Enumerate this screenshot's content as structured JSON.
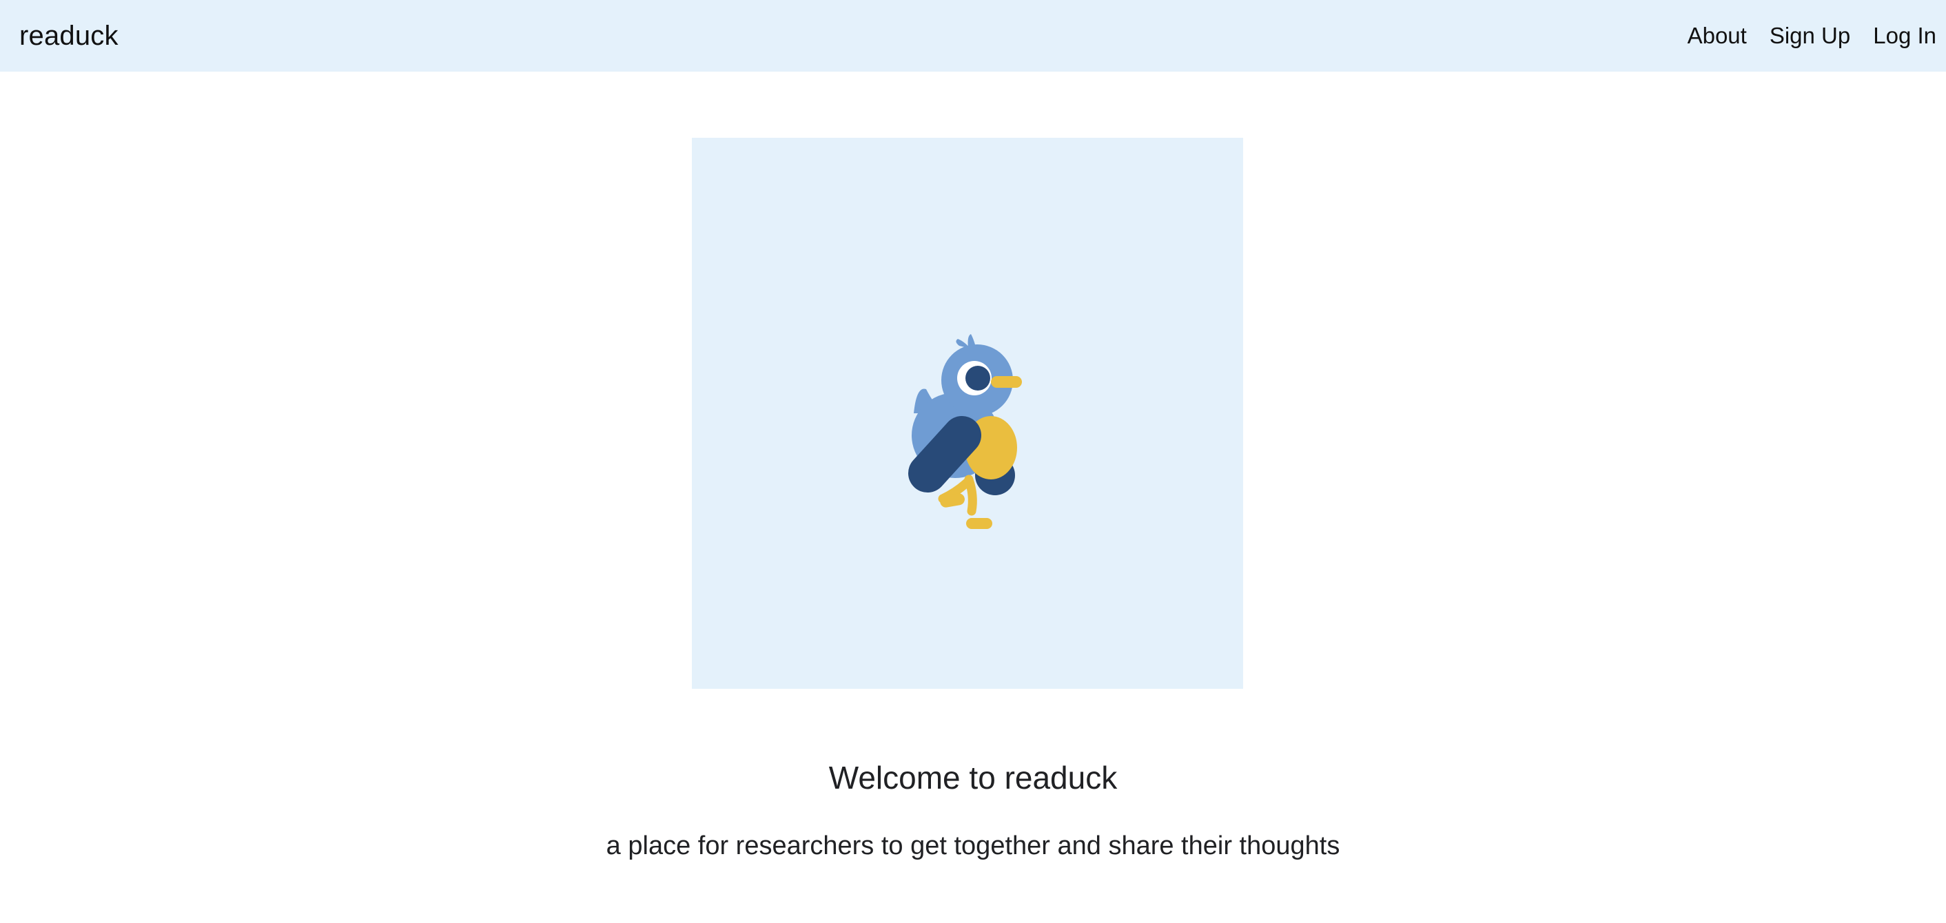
{
  "navbar": {
    "brand": "readuck",
    "links": [
      {
        "label": "About"
      },
      {
        "label": "Sign Up"
      },
      {
        "label": "Log In"
      }
    ]
  },
  "hero": {
    "illustration": "duck-mascot-icon",
    "title": "Welcome to readuck",
    "subtitle": "a place for researchers to get together and share their thoughts"
  },
  "colors": {
    "navbar_bg": "#e4f1fb",
    "hero_bg": "#e4f1fb",
    "duck_body": "#6f9cd3",
    "duck_dark": "#284a78",
    "duck_yellow": "#eabe3f"
  }
}
